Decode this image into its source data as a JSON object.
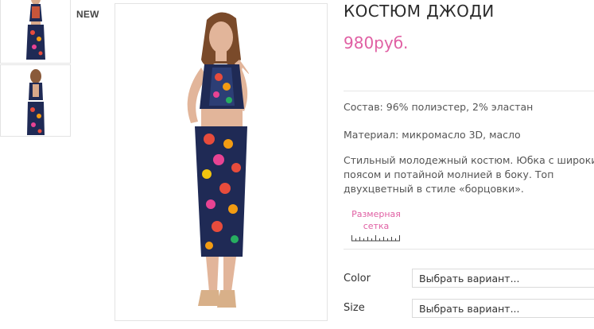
{
  "badge": {
    "new_label": "NEW"
  },
  "product": {
    "title": "КОСТЮМ ДЖОДИ",
    "price": "980руб.",
    "composition": "Состав: 96% полиэстер, 2% эластан",
    "material": "Материал: микромасло 3D, масло",
    "description_lines": [
      "Стильный молодежный костюм. Юбка с широким",
      "поясом и потайной молнией в боку. Топ",
      "двухцветный в стиле «борцовки»."
    ]
  },
  "size_chart": {
    "label_lines": [
      "Размерная",
      "сетка"
    ]
  },
  "options": [
    {
      "label": "Color",
      "placeholder": "Выбрать вариант..."
    },
    {
      "label": "Size",
      "placeholder": "Выбрать вариант..."
    }
  ],
  "colors": {
    "accent": "#e05fa3",
    "text": "#555555",
    "border": "#e3e3e3"
  },
  "icons": [
    "ruler-icon"
  ]
}
